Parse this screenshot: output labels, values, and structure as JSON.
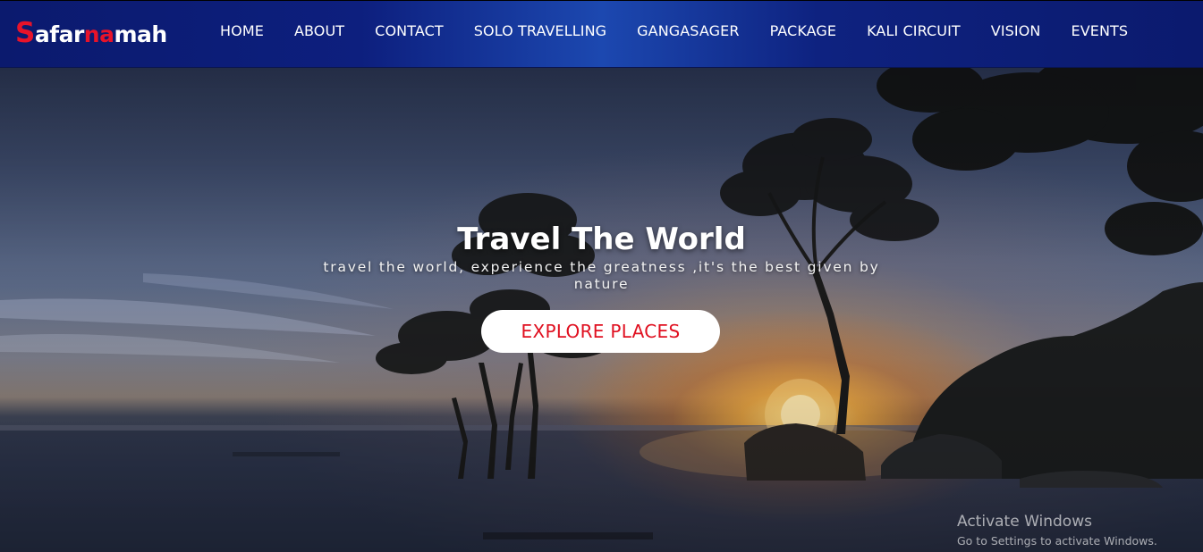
{
  "navbar": {
    "logo": {
      "first": "S",
      "part1": "afar",
      "part2": "na",
      "part3": "mah"
    },
    "links": [
      "HOME",
      "ABOUT",
      "CONTACT",
      "SOLO TRAVELLING",
      "GANGASAGER",
      "PACKAGE",
      "KALI CIRCUIT",
      "VISION",
      "EVENTS"
    ]
  },
  "hero": {
    "title": "Travel The World",
    "subtitle": "travel the world, experience the greatness ,it's the best given by nature",
    "button_label": "EXPLORE PLACES"
  },
  "watermark": {
    "line1": "Activate Windows",
    "line2": "Go to Settings to activate Windows."
  },
  "colors": {
    "nav_bg": "#0d1f7e",
    "logo_accent": "#e8132a",
    "button_text": "#e01020",
    "button_bg": "#ffffff"
  }
}
